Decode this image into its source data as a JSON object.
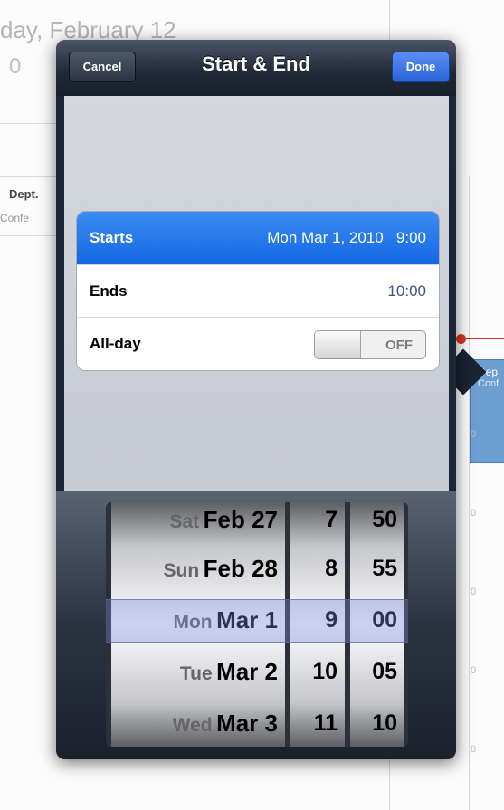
{
  "background": {
    "date_heading": "day, February 12",
    "date_sub": "0",
    "event_title": "Dept.",
    "event_sub": "Confe",
    "side_event_title": "Dep",
    "side_event_sub": "Conf",
    "tick_marks": [
      "0",
      "0",
      "0",
      "0",
      "0",
      "0"
    ]
  },
  "popover": {
    "title": "Start & End",
    "cancel_label": "Cancel",
    "done_label": "Done",
    "rows": {
      "starts": {
        "label": "Starts",
        "value": "Mon Mar 1, 2010   9:00"
      },
      "ends": {
        "label": "Ends",
        "value": "10:00"
      },
      "allday": {
        "label": "All-day",
        "toggle": "OFF"
      }
    }
  },
  "picker": {
    "dates": [
      {
        "dow": "Sat",
        "date": "Feb 27"
      },
      {
        "dow": "Sun",
        "date": "Feb 28"
      },
      {
        "dow": "Mon",
        "date": "Mar 1"
      },
      {
        "dow": "Tue",
        "date": "Mar 2"
      },
      {
        "dow": "Wed",
        "date": "Mar 3"
      }
    ],
    "hours": [
      "7",
      "8",
      "9",
      "10",
      "11"
    ],
    "minutes": [
      "50",
      "55",
      "00",
      "05",
      "10"
    ]
  },
  "colors": {
    "selected_row": "#1a6ee6",
    "done_button": "#3a74e6",
    "now_indicator": "#d32f2f"
  }
}
